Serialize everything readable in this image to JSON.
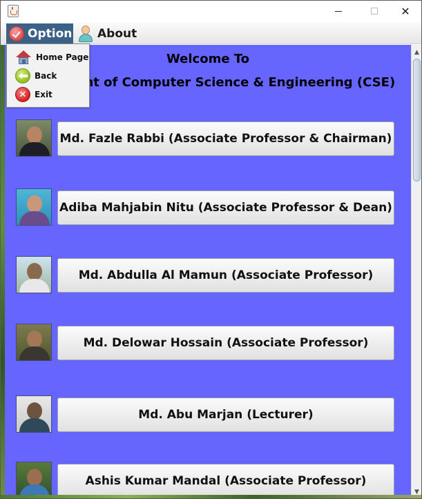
{
  "window": {
    "title": "",
    "controls": {
      "minimize": "—",
      "maximize": "☐",
      "close": "✕"
    }
  },
  "menubar": {
    "option_label": "Option",
    "about_label": "About"
  },
  "popup_menu": {
    "items": [
      {
        "label": "Home Page",
        "icon": "home-icon"
      },
      {
        "label": "Back",
        "icon": "back-arrow-icon"
      },
      {
        "label": "Exit",
        "icon": "exit-icon"
      }
    ]
  },
  "main": {
    "welcome_line1": "Welcome To",
    "welcome_line2": "Department of Computer Science & Engineering (CSE)",
    "faculty": [
      {
        "label": "Md. Fazle Rabbi (Associate Professor & Chairman)"
      },
      {
        "label": "Adiba Mahjabin Nitu (Associate Professor & Dean)"
      },
      {
        "label": "Md. Abdulla Al Mamun (Associate Professor)"
      },
      {
        "label": "Md. Delowar Hossain (Associate Professor)"
      },
      {
        "label": "Md. Abu Marjan (Lecturer)"
      },
      {
        "label": "Ashis Kumar Mandal (Associate Professor)"
      }
    ]
  },
  "colors": {
    "content_background": "#6666ff",
    "menu_selected": "#3b6286"
  }
}
